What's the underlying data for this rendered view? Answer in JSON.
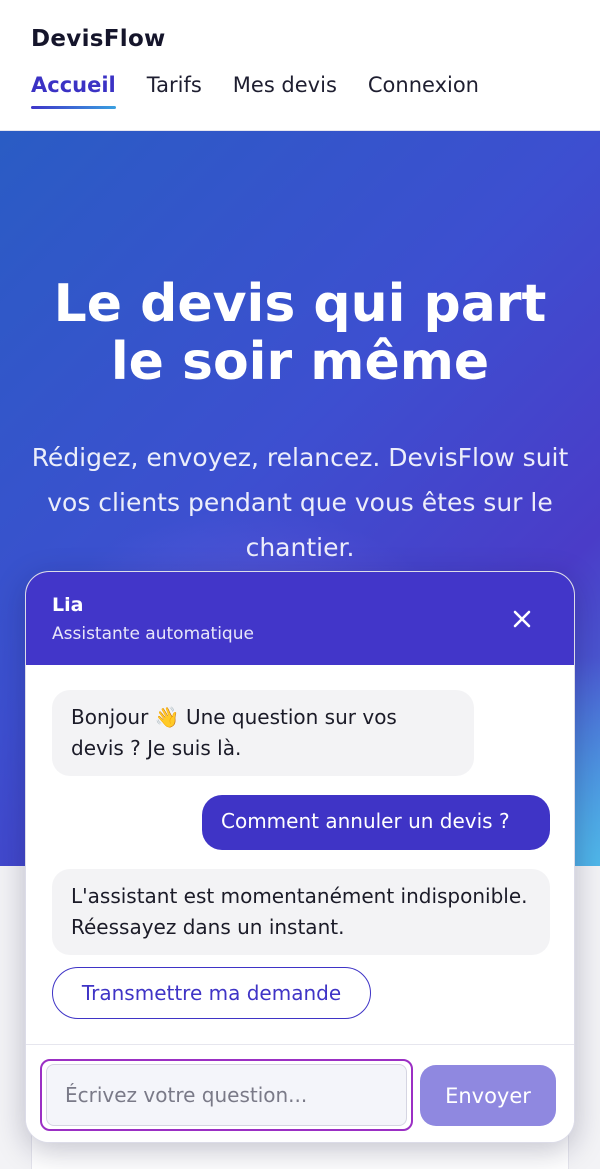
{
  "header": {
    "brand": "DevisFlow",
    "nav": [
      {
        "label": "Accueil",
        "active": true
      },
      {
        "label": "Tarifs",
        "active": false
      },
      {
        "label": "Mes devis",
        "active": false
      },
      {
        "label": "Connexion",
        "active": false
      }
    ]
  },
  "hero": {
    "title_line1": "Le devis qui part",
    "title_line2": "le soir même",
    "subtitle": "Rédigez, envoyez, relancez. DevisFlow suit vos clients pendant que vous êtes sur le chantier."
  },
  "chat": {
    "agent_name": "Lia",
    "agent_role": "Assistante automatique",
    "close_icon": "close-icon",
    "messages": [
      {
        "from": "bot",
        "text": "Bonjour 👋 Une question sur vos devis ? Je suis là."
      },
      {
        "from": "user",
        "text": "Comment annuler un devis ?"
      },
      {
        "from": "bot",
        "text": "L'assistant est momentanément indisponible. Réessayez dans un instant."
      }
    ],
    "handoff_label": "Transmettre ma demande",
    "input": {
      "value": "",
      "placeholder": "Écrivez votre question..."
    },
    "send_label": "Envoyer"
  },
  "colors": {
    "accent": "#3f34c6",
    "chat_header": "#4236c9",
    "send_disabled": "#8f88e0",
    "focus_ring": "#9b2fc4"
  }
}
